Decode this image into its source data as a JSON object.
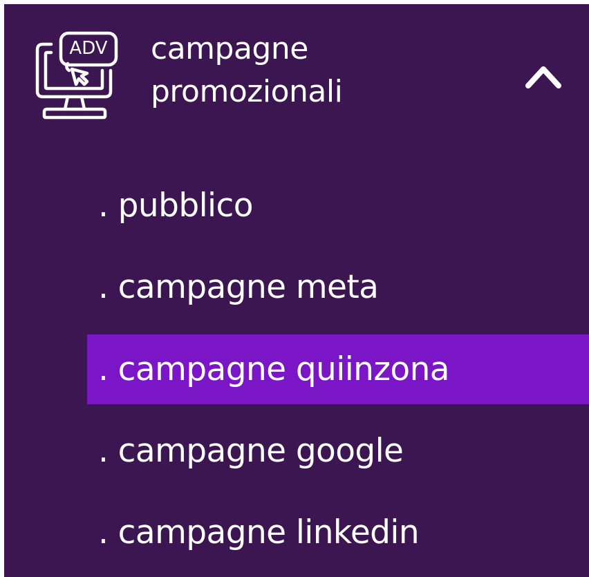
{
  "menu": {
    "title_line1": "campagne",
    "title_line2": "promozionali",
    "icon": "adv-monitor-icon",
    "icon_text": "ADV",
    "expanded": true,
    "toggle_icon": "chevron-up-icon",
    "items": [
      {
        "label": ". pubblico",
        "active": false
      },
      {
        "label": ". campagne meta",
        "active": false
      },
      {
        "label": ". campagne quiinzona",
        "active": true
      },
      {
        "label": ". campagne google",
        "active": false
      },
      {
        "label": ". campagne linkedin",
        "active": false
      }
    ]
  },
  "colors": {
    "panel_background": "#3c1650",
    "active_item_background": "#7a16c6",
    "text": "#ffffff",
    "outer_background": "#ffffff"
  }
}
